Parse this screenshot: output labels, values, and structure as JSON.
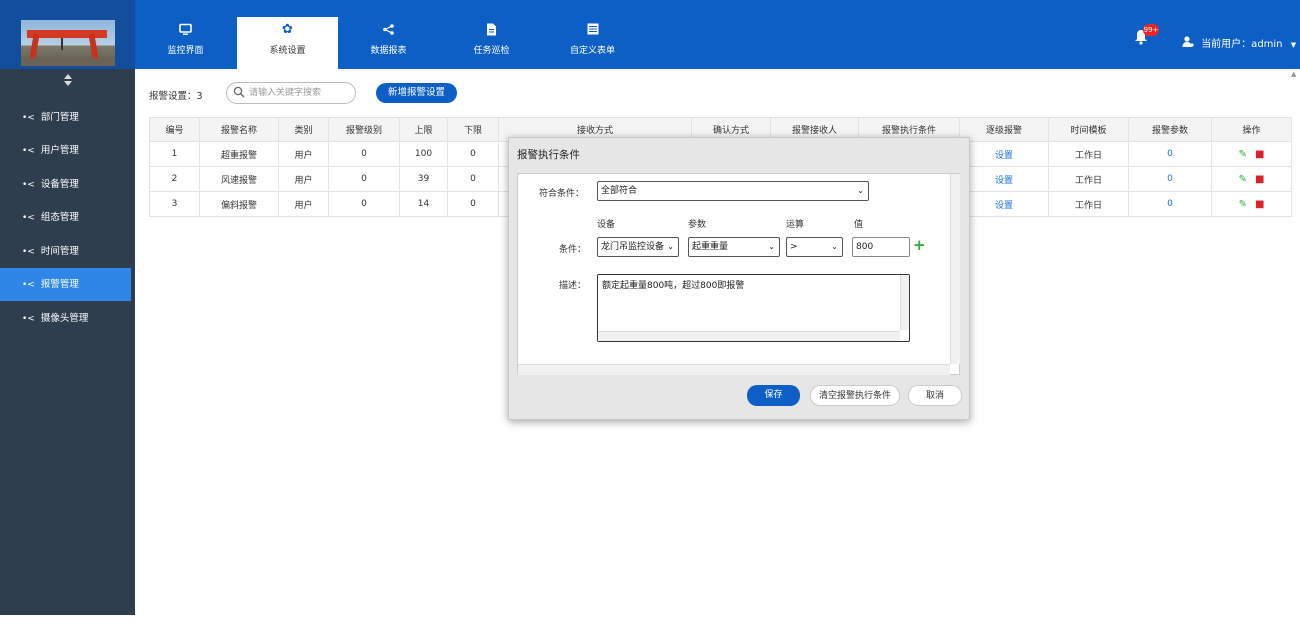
{
  "header": {
    "tabs": [
      {
        "label": "监控界面",
        "icon": "monitor-icon"
      },
      {
        "label": "系统设置",
        "icon": "gear-icon"
      },
      {
        "label": "数据报表",
        "icon": "share-icon"
      },
      {
        "label": "任务巡检",
        "icon": "document-icon"
      },
      {
        "label": "自定义表单",
        "icon": "form-icon"
      }
    ],
    "active_tab": "系统设置",
    "notification_count": "99+",
    "user_label": "当前用户：admin"
  },
  "sidebar": {
    "items": [
      {
        "label": "部门管理"
      },
      {
        "label": "用户管理"
      },
      {
        "label": "设备管理"
      },
      {
        "label": "组态管理"
      },
      {
        "label": "时间管理"
      },
      {
        "label": "报警管理"
      },
      {
        "label": "摄像头管理"
      }
    ],
    "active_item": "报警管理"
  },
  "toolbar": {
    "count_label": "报警设置：3",
    "search_placeholder": "请输入关键字搜索",
    "add_label": "新增报警设置"
  },
  "table": {
    "headers": [
      "编号",
      "报警名称",
      "类别",
      "报警级别",
      "上限",
      "下限",
      "接收方式",
      "确认方式",
      "报警接收人",
      "报警执行条件",
      "逐级报警",
      "时间模板",
      "报警参数",
      "操作"
    ],
    "rows": [
      {
        "id": "1",
        "name": "超重报警",
        "type": "用户",
        "level": "0",
        "upper": "100",
        "lower": "0",
        "escalate": "设置",
        "template": "工作日",
        "params": "0"
      },
      {
        "id": "2",
        "name": "风速报警",
        "type": "用户",
        "level": "0",
        "upper": "39",
        "lower": "0",
        "escalate": "设置",
        "template": "工作日",
        "params": "0"
      },
      {
        "id": "3",
        "name": "偏斜报警",
        "type": "用户",
        "level": "0",
        "upper": "14",
        "lower": "0",
        "escalate": "设置",
        "template": "工作日",
        "params": "0"
      }
    ]
  },
  "modal": {
    "title": "报警执行条件",
    "match_label": "符合条件：",
    "match_value": "全部符合",
    "col_device": "设备",
    "col_param": "参数",
    "col_op": "运算",
    "col_value": "值",
    "condition_label": "条件：",
    "device_value": "龙门吊监控设备",
    "param_value": "起重重量",
    "op_value": ">",
    "value": "800",
    "desc_label": "描述：",
    "desc_value": "额定起重量800吨，超过800即报警",
    "save_label": "保存",
    "clear_label": "清空报警执行条件",
    "cancel_label": "取消"
  },
  "colors": {
    "header_bg": "#0d5fc6",
    "sidebar_bg": "#2f3e4f",
    "sidebar_active": "#2f86e6",
    "link": "#1a73e8",
    "edit_green": "#2bab3a",
    "delete_red": "#d8232a"
  }
}
